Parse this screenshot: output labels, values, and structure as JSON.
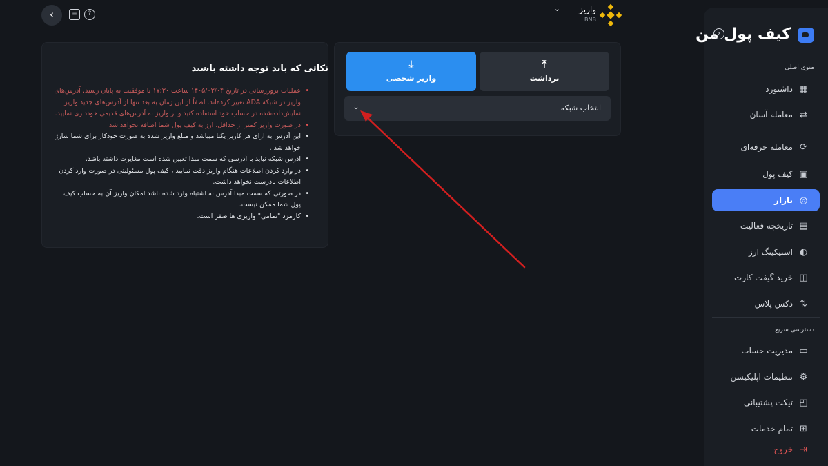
{
  "colors": {
    "accent": "#2b8ef0",
    "active_nav": "#4a7ef6",
    "warning": "#c45a5a",
    "annotation_arrow": "#d21f1f",
    "coin": "#f0b90b"
  },
  "sidebar": {
    "brand_name": "کیف پول من",
    "main_section_title": "منوی اصلی",
    "quick_section_title": "دسترسی سریع",
    "main_items": [
      {
        "label": "داشبورد",
        "icon": "dashboard-icon",
        "active": false
      },
      {
        "label": "معامله آسان",
        "icon": "easy-trade-icon",
        "active": false
      },
      {
        "label": "معامله حرفه‌ای",
        "icon": "pro-trade-icon",
        "active": false
      },
      {
        "label": "کیف پول",
        "icon": "wallet-icon",
        "active": false
      },
      {
        "label": "بازار",
        "icon": "market-icon",
        "active": true
      },
      {
        "label": "تاریخچه فعالیت",
        "icon": "history-icon",
        "active": false
      },
      {
        "label": "استیکینگ ارز",
        "icon": "staking-icon",
        "active": false
      },
      {
        "label": "خرید گیفت کارت",
        "icon": "gift-card-icon",
        "active": false
      },
      {
        "label": "دکس پلاس",
        "icon": "dex-icon",
        "active": false
      }
    ],
    "quick_items": [
      {
        "label": "مدیریت حساب",
        "icon": "account-icon"
      },
      {
        "label": "تنظیمات اپلیکیشن",
        "icon": "settings-icon"
      },
      {
        "label": "تیکت پشتیبانی",
        "icon": "support-icon"
      },
      {
        "label": "تمام خدمات",
        "icon": "services-icon"
      }
    ],
    "logout_label": "خروج"
  },
  "header": {
    "title": "واریز",
    "coin_symbol": "BNB",
    "coin_icon": "bnb-icon"
  },
  "actions": {
    "deposit_label": "واریز شخصی",
    "withdraw_label": "برداشت"
  },
  "network_select": {
    "label": "انتخاب شبکه"
  },
  "notes": {
    "title": "نکاتی که باید توجه داشته باشید",
    "items": [
      {
        "text": "عملیات بروزرسانی در تاریخ ۱۴۰۵/۰۳/۰۴ ساعت ۱۷:۳۰ با موفقیت به پایان رسید. آدرس‌های واریز در شبکه ADA تغییر کرده‌اند. لطفاً از این زمان به بعد تنها از آدرس‌های جدید واریز نمایش‌داده‌شده در حساب خود استفاده کنید و از واریز به آدرس‌های قدیمی خودداری نمایید.",
        "warning": true
      },
      {
        "text": "در صورت واریز کمتر از حداقل، ارز به کیف پول شما اضافه نخواهد شد.",
        "warning": true
      },
      {
        "text": "این آدرس به ازای هر کاربر یکتا میباشد و مبلغ واریز شده به صورت خودکار برای شما شارژ خواهد شد .",
        "warning": false
      },
      {
        "text": "آدرس شبکه نباید با آدرسی که سمت مبدا تعیین شده است مغایرت داشته باشد.",
        "warning": false
      },
      {
        "text": "در وارد کردن اطلاعات هنگام واریز دقت نمایید ، کیف پول مسئولیتی در صورت وارد کردن اطلاعات نادرست نخواهد داشت.",
        "warning": false
      },
      {
        "text": "در صورتی که سمت مبدا آدرس به اشتباه وارد شده باشد امکان واریز آن به حساب کیف پول شما ممکن نیست.",
        "warning": false
      },
      {
        "text": "کارمزد \"تمامی\" واریزی ها صفر است.",
        "warning": false
      }
    ]
  }
}
